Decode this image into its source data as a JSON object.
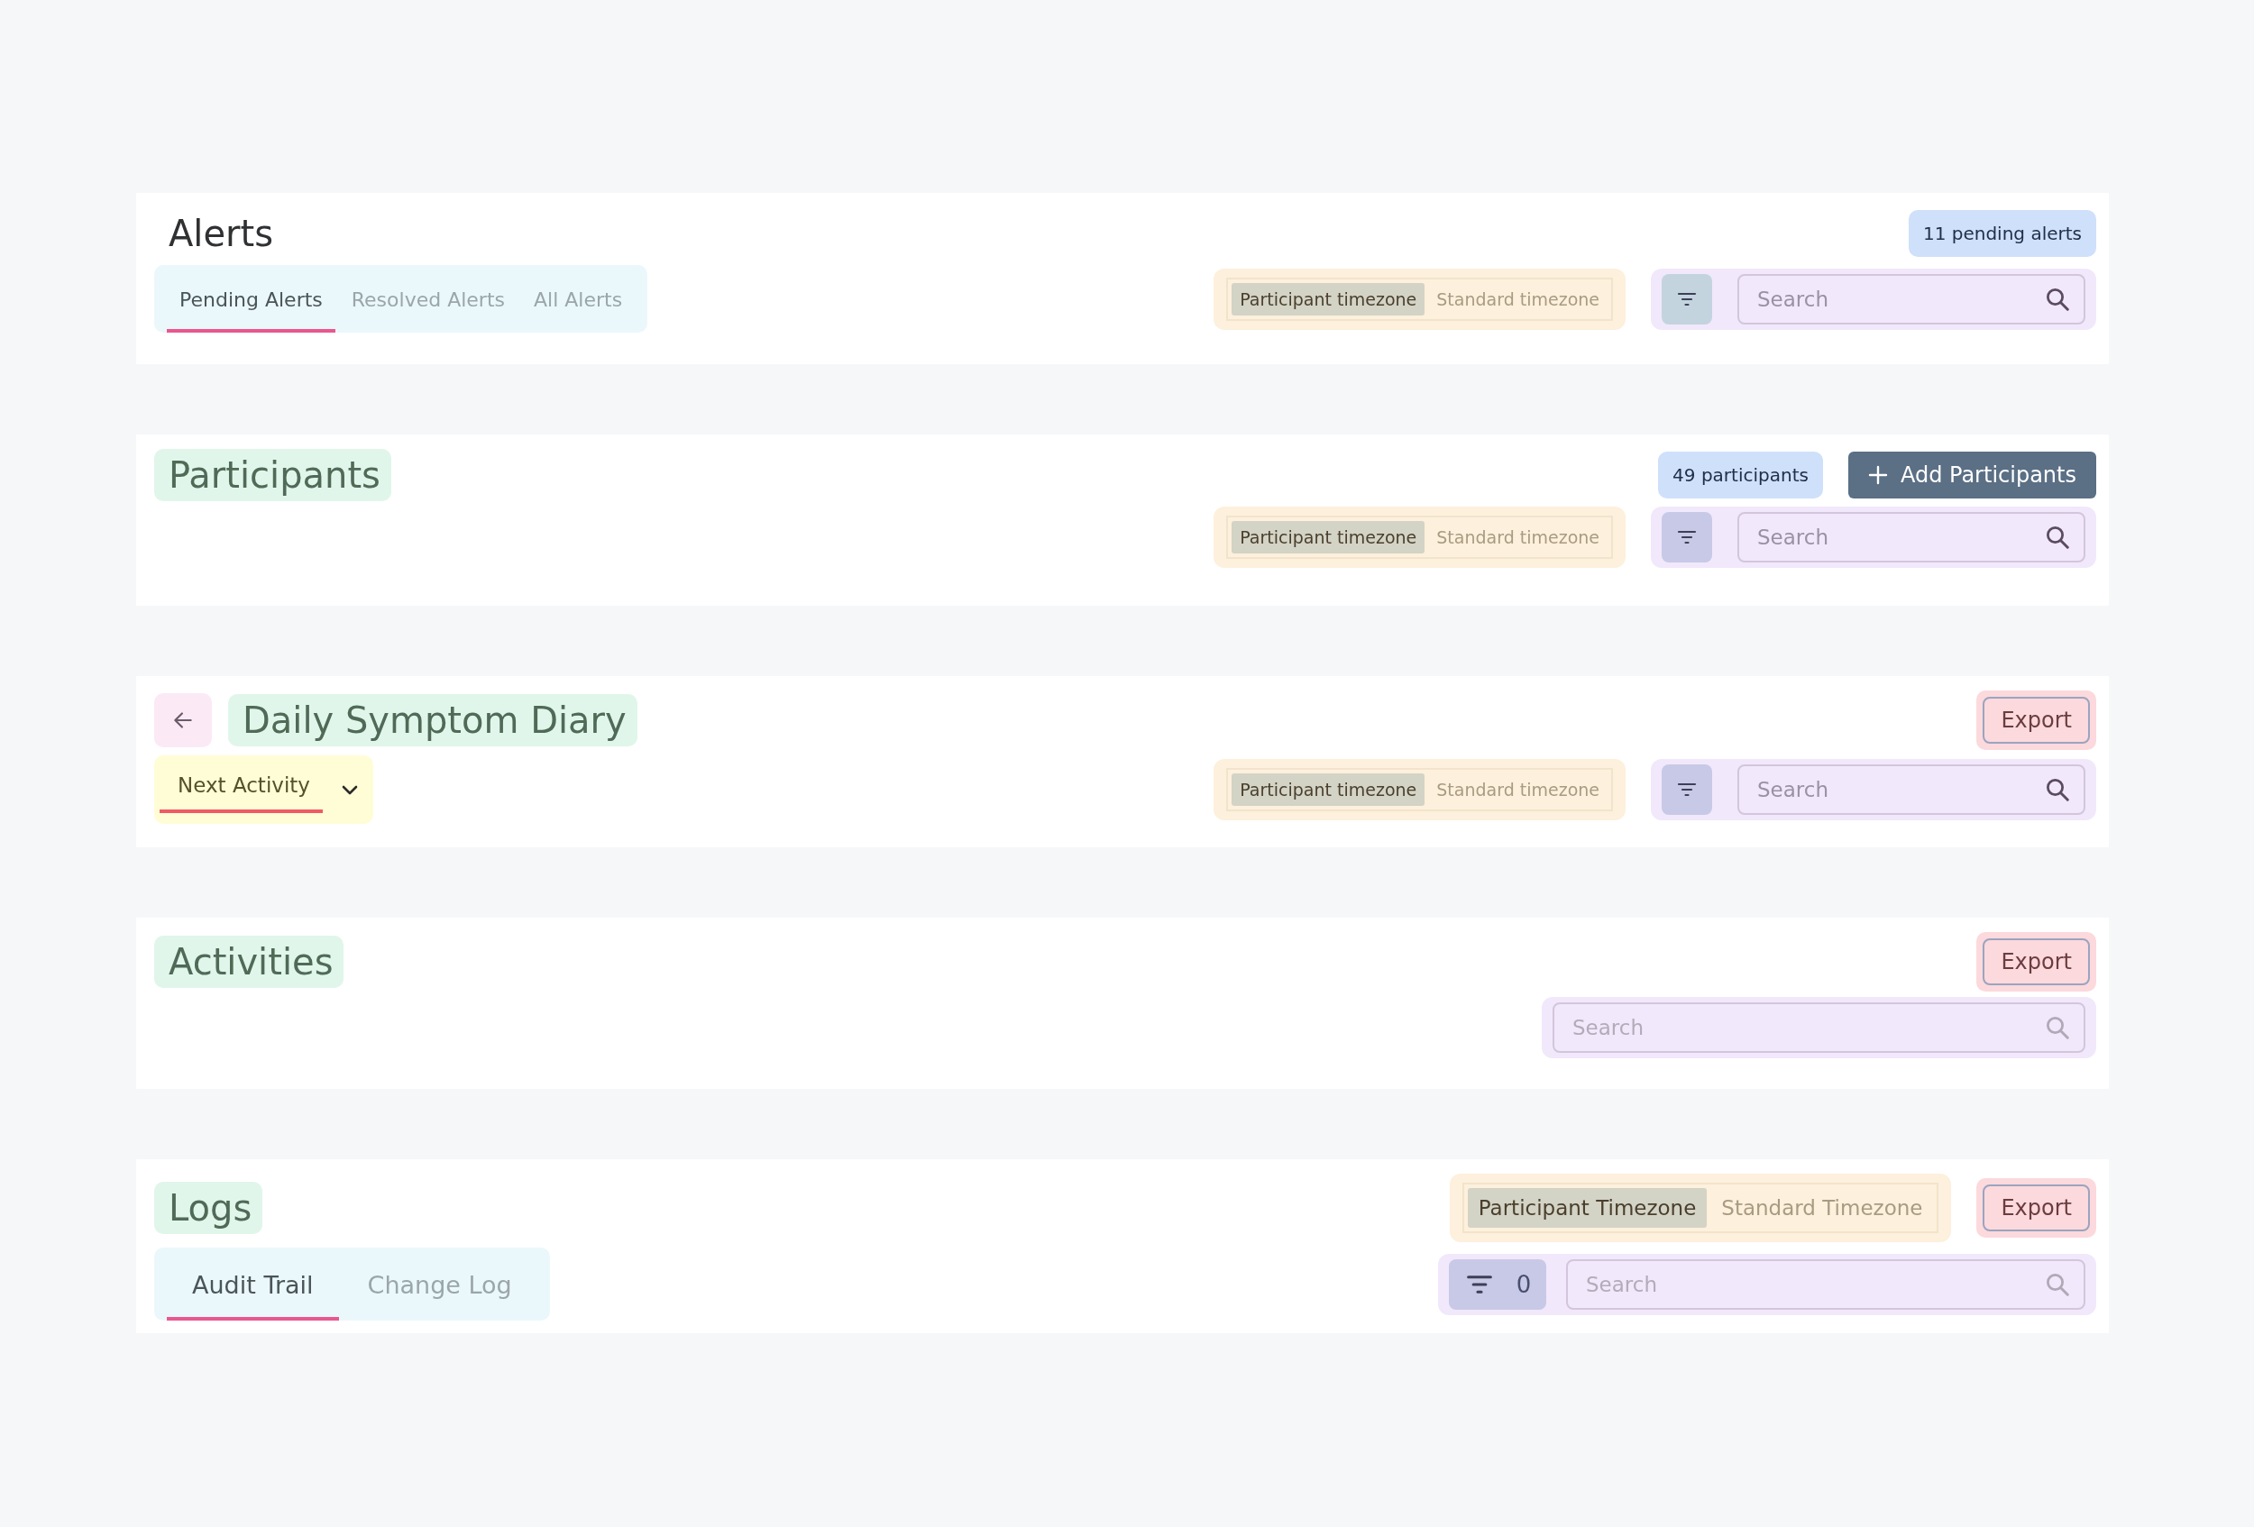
{
  "sections": [
    {
      "header": {
        "title": "Alerts",
        "title_highlighted": false,
        "count": "11 pending alerts"
      },
      "toolbar": {
        "tabs": [
          {
            "label": "Pending Alerts",
            "selected": true
          },
          {
            "label": "Resolved Alerts",
            "selected": false
          },
          {
            "label": "All Alerts",
            "selected": false
          }
        ],
        "timezone": [
          {
            "label": "Participant timezone",
            "selected": true
          },
          {
            "label": "Standard timezone",
            "selected": false
          }
        ],
        "filter": true,
        "search": {
          "placeholder": "Search"
        }
      }
    },
    {
      "header": {
        "title": "Participants",
        "title_highlighted": true,
        "count": "49 participants",
        "add_button": "Add Participants"
      },
      "toolbar": {
        "timezone": [
          {
            "label": "Participant timezone",
            "selected": true
          },
          {
            "label": "Standard timezone",
            "selected": false
          }
        ],
        "filter": true,
        "search": {
          "placeholder": "Search"
        }
      }
    },
    {
      "header": {
        "back": true,
        "title": "Daily Symptom Diary",
        "title_highlighted": true,
        "export": "Export"
      },
      "toolbar": {
        "dropdown": "Next Activity",
        "timezone": [
          {
            "label": "Participant timezone",
            "selected": true
          },
          {
            "label": "Standard timezone",
            "selected": false
          }
        ],
        "filter": true,
        "search": {
          "placeholder": "Search"
        }
      }
    },
    {
      "header": {
        "title": "Activities",
        "title_highlighted": true,
        "export": "Export"
      },
      "toolbar": {
        "search": {
          "placeholder": "Search"
        }
      }
    },
    {
      "header": {
        "title": "Logs",
        "title_highlighted": true,
        "timezone": [
          {
            "label": "Participant Timezone",
            "selected": true
          },
          {
            "label": "Standard Timezone",
            "selected": false
          }
        ],
        "export": "Export"
      },
      "toolbar": {
        "tabs": [
          {
            "label": "Audit Trail",
            "selected": true
          },
          {
            "label": "Change Log",
            "selected": false
          }
        ],
        "filter": true,
        "filter_count": "0",
        "search": {
          "placeholder": "Search"
        }
      }
    }
  ]
}
